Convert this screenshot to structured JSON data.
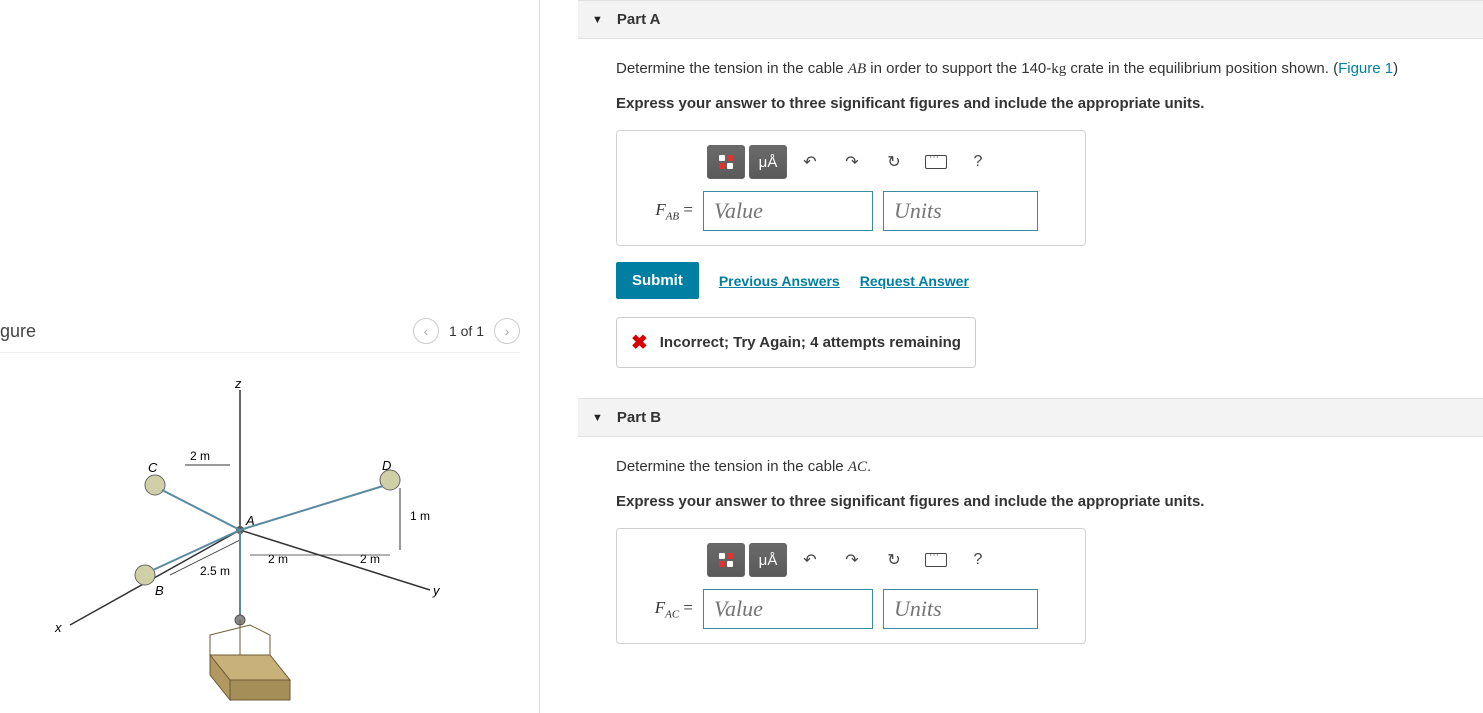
{
  "figure": {
    "title": "gure",
    "pager": {
      "label": "1 of 1"
    },
    "labels": {
      "z": "z",
      "x": "x",
      "y": "y",
      "A": "A",
      "B": "B",
      "C": "C",
      "D": "D",
      "d1": "2 m",
      "d2": "1 m",
      "d3": "2 m",
      "d4": "2 m",
      "d5": "2.5 m"
    }
  },
  "partA": {
    "title": "Part A",
    "question_pre": "Determine the tension in the cable ",
    "question_var": "AB",
    "question_mid": " in order to support the 140-",
    "question_unit": "kg",
    "question_post": " crate in the equilibrium position shown. (",
    "figlink": "Figure 1",
    "question_close": ")",
    "instruction": "Express your answer to three significant figures and include the appropriate units.",
    "var_label": "F",
    "var_sub": "AB",
    "eq": " = ",
    "value_ph": "Value",
    "units_ph": "Units",
    "submit": "Submit",
    "prev": "Previous Answers",
    "req": "Request Answer",
    "feedback": "Incorrect; Try Again; 4 attempts remaining",
    "toolbar": {
      "units": "μÅ",
      "help": "?"
    }
  },
  "partB": {
    "title": "Part B",
    "question_pre": "Determine the tension in the cable ",
    "question_var": "AC",
    "question_post": ".",
    "instruction": "Express your answer to three significant figures and include the appropriate units.",
    "var_label": "F",
    "var_sub": "AC",
    "eq": " = ",
    "value_ph": "Value",
    "units_ph": "Units",
    "toolbar": {
      "units": "μÅ",
      "help": "?"
    }
  }
}
